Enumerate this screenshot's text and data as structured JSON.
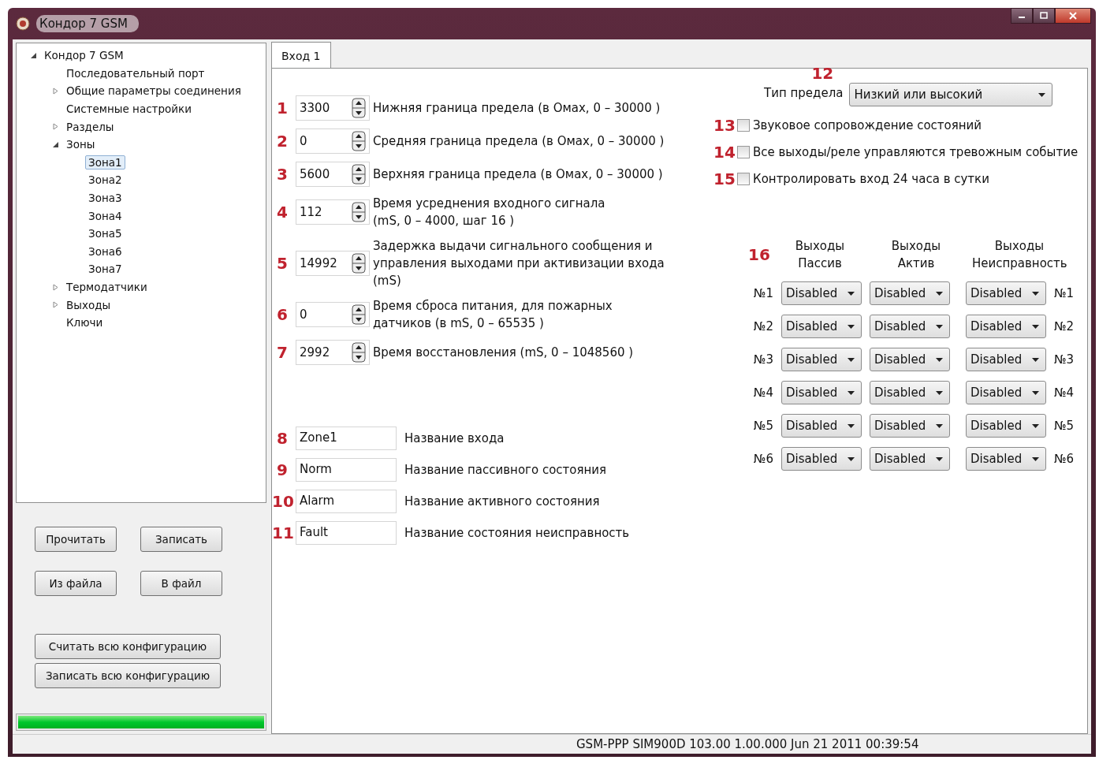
{
  "window": {
    "title": "Кондор 7 GSM"
  },
  "tree": [
    {
      "label": "Кондор 7 GSM",
      "selected": false,
      "expanded": true,
      "children": [
        {
          "label": "Последовательный порт",
          "selected": false
        },
        {
          "label": "Общие параметры соединения",
          "selected": false,
          "expanded": false
        },
        {
          "label": "Системные настройки",
          "selected": false
        },
        {
          "label": "Разделы",
          "selected": false,
          "expanded": false
        },
        {
          "label": "Зоны",
          "selected": false,
          "expanded": true,
          "children": [
            {
              "label": "Зона1",
              "selected": true
            },
            {
              "label": "Зона2",
              "selected": false
            },
            {
              "label": "Зона3",
              "selected": false
            },
            {
              "label": "Зона4",
              "selected": false
            },
            {
              "label": "Зона5",
              "selected": false
            },
            {
              "label": "Зона6",
              "selected": false
            },
            {
              "label": "Зона7",
              "selected": false
            }
          ]
        },
        {
          "label": "Термодатчики",
          "selected": false,
          "expanded": false
        },
        {
          "label": "Выходы",
          "selected": false,
          "expanded": false
        },
        {
          "label": "Ключи",
          "selected": false
        }
      ]
    }
  ],
  "buttons": [
    [
      "Прочитать",
      "Записать"
    ],
    [
      "Из файла",
      "В файл"
    ]
  ],
  "config_buttons": [
    "Считать всю конфигурацию",
    "Записать всю конфигурацию"
  ],
  "progress": {
    "level": 1.0
  },
  "tabs": [
    {
      "label": "Вход 1",
      "selected": true
    }
  ],
  "spin_rows": [
    {
      "marker": "1",
      "value": "3300",
      "label": "Нижняя граница предела (в Омах, 0 – 30000 )"
    },
    {
      "marker": "2",
      "value": "0",
      "label": "Средняя граница предела (в Омах, 0 – 30000 )"
    },
    {
      "marker": "3",
      "value": "5600",
      "label": "Верхняя граница предела (в Омах, 0 – 30000 )"
    },
    {
      "marker": "4",
      "value": "112",
      "label": "Время усреднения входного сигнала (mS, 0 – 4000, шаг 16 )"
    },
    {
      "marker": "5",
      "value": "14992",
      "label": "Задержка выдачи сигнального сообщения и управления выходами при активизации входа (mS)"
    },
    {
      "marker": "6",
      "value": "0",
      "label": "Время сброса питания, для пожарных датчиков (в mS, 0 – 65535 )"
    },
    {
      "marker": "7",
      "value": "2992",
      "label": "Время восстановления (mS, 0 – 1048560 )"
    }
  ],
  "name_rows": [
    {
      "marker": "8",
      "value": "Zone1",
      "label": "Название входа"
    },
    {
      "marker": "9",
      "value": "Norm",
      "label": "Название пассивного состояния"
    },
    {
      "marker": "10",
      "value": "Alarm",
      "label": "Название активного состояния"
    },
    {
      "marker": "11",
      "value": "Fault",
      "label": "Название состояния неисправность"
    }
  ],
  "limit_type": {
    "marker": "12",
    "label": "Тип предела",
    "value": "Низкий или высокий"
  },
  "checkboxes": [
    {
      "marker": "13",
      "label": "Звуковое сопровождение состояний",
      "checked": false
    },
    {
      "marker": "14",
      "label": "Все выходы/реле управляются тревожным событие",
      "checked": false
    },
    {
      "marker": "15",
      "label": "Контролировать вход 24 часа в сутки",
      "checked": false
    }
  ],
  "outputs": {
    "marker": "16",
    "columns": [
      {
        "title": "Выходы",
        "subtitle": "Пассив"
      },
      {
        "title": "Выходы",
        "subtitle": "Актив"
      },
      {
        "title": "Выходы",
        "subtitle": "Неисправность"
      }
    ],
    "rows": [
      {
        "label": "№1",
        "values": [
          "Disabled",
          "Disabled",
          "Disabled"
        ],
        "label_right": "№1"
      },
      {
        "label": "№2",
        "values": [
          "Disabled",
          "Disabled",
          "Disabled"
        ],
        "label_right": "№2"
      },
      {
        "label": "№3",
        "values": [
          "Disabled",
          "Disabled",
          "Disabled"
        ],
        "label_right": "№3"
      },
      {
        "label": "№4",
        "values": [
          "Disabled",
          "Disabled",
          "Disabled"
        ],
        "label_right": "№4"
      },
      {
        "label": "№5",
        "values": [
          "Disabled",
          "Disabled",
          "Disabled"
        ],
        "label_right": "№5"
      },
      {
        "label": "№6",
        "values": [
          "Disabled",
          "Disabled",
          "Disabled"
        ],
        "label_right": "№6"
      }
    ]
  },
  "status_bar": "GSM-PPP SIM900D 103.00 1.00.000 Jun 21 2011 00:39:54"
}
